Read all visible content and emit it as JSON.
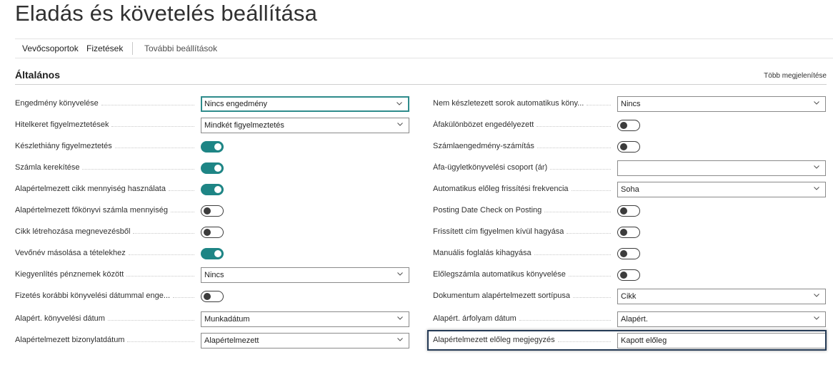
{
  "page": {
    "title": "Eladás és követelés beállítása"
  },
  "actions": {
    "customer_groups": "Vevőcsoportok",
    "payments": "Fizetések",
    "more_settings": "További beállítások"
  },
  "section": {
    "title": "Általános",
    "show_more": "Több megjelenítése"
  },
  "left": [
    {
      "label": "Engedmény könyvelése",
      "type": "select",
      "value": "Nincs engedmény",
      "focused": true
    },
    {
      "label": "Hitelkeret figyelmeztetések",
      "type": "select",
      "value": "Mindkét figyelmeztetés"
    },
    {
      "label": "Készlethiány figyelmeztetés",
      "type": "toggle",
      "checked": true
    },
    {
      "label": "Számla kerekítése",
      "type": "toggle",
      "checked": true
    },
    {
      "label": "Alapértelmezett cikk mennyiség használata",
      "type": "toggle",
      "checked": true
    },
    {
      "label": "Alapértelmezett főkönyvi számla mennyiség",
      "type": "toggle",
      "checked": false
    },
    {
      "label": "Cikk létrehozása megnevezésből",
      "type": "toggle",
      "checked": false
    },
    {
      "label": "Vevőnév másolása a tételekhez",
      "type": "toggle",
      "checked": true
    },
    {
      "label": "Kiegyenlítés pénznemek között",
      "type": "select",
      "value": "Nincs"
    },
    {
      "label": "Fizetés korábbi könyvelési dátummal enge...",
      "type": "toggle",
      "checked": false
    },
    {
      "label": "Alapért. könyvelési dátum",
      "type": "select",
      "value": "Munkadátum"
    },
    {
      "label": "Alapértelmezett bizonylatdátum",
      "type": "select",
      "value": "Alapértelmezett"
    }
  ],
  "right": [
    {
      "label": "Nem készletezett sorok automatikus köny...",
      "type": "select",
      "value": "Nincs"
    },
    {
      "label": "Áfakülönbözet engedélyezett",
      "type": "toggle",
      "checked": false
    },
    {
      "label": "Számlaengedmény-számítás",
      "type": "toggle",
      "checked": false
    },
    {
      "label": "Áfa-ügyletkönyvelési csoport (ár)",
      "type": "select",
      "value": ""
    },
    {
      "label": "Automatikus előleg frissítési frekvencia",
      "type": "select",
      "value": "Soha"
    },
    {
      "label": "Posting Date Check on Posting",
      "type": "toggle",
      "checked": false
    },
    {
      "label": "Frissített cím figyelmen kívül hagyása",
      "type": "toggle",
      "checked": false
    },
    {
      "label": "Manuális foglalás kihagyása",
      "type": "toggle",
      "checked": false
    },
    {
      "label": "Előlegszámla automatikus könyvelése",
      "type": "toggle",
      "checked": false
    },
    {
      "label": "Dokumentum alapértelmezett sortípusa",
      "type": "select",
      "value": "Cikk"
    },
    {
      "label": "Alapért. árfolyam dátum",
      "type": "select",
      "value": "Alapért."
    },
    {
      "label": "Alapértelmezett előleg megjegyzés",
      "type": "text",
      "value": "Kapott előleg",
      "highlighted": true
    }
  ],
  "colors": {
    "toggle_on": "#1e8585",
    "focus_border": "#2e8b8b",
    "highlight_border": "#243a55"
  }
}
